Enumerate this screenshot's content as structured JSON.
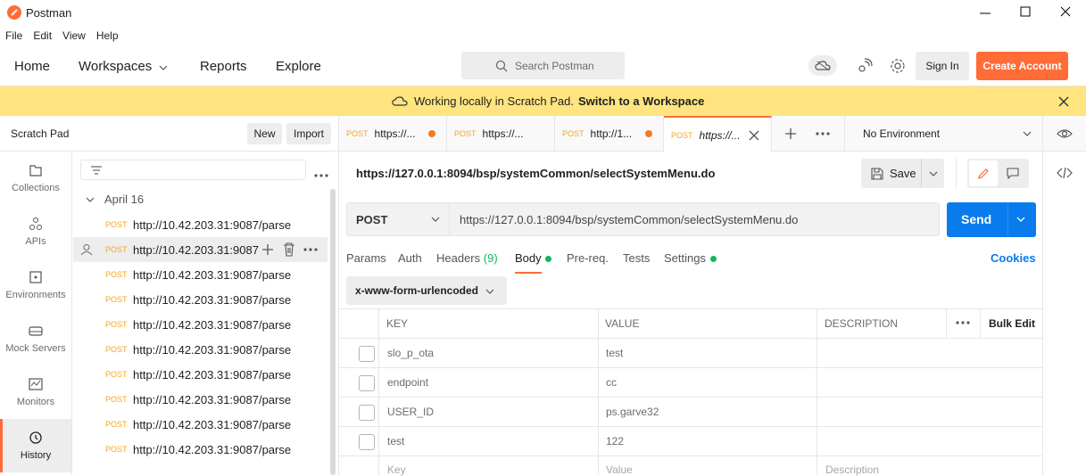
{
  "app": {
    "title": "Postman"
  },
  "menu": [
    "File",
    "Edit",
    "View",
    "Help"
  ],
  "nav": {
    "home": "Home",
    "workspaces": "Workspaces",
    "reports": "Reports",
    "explore": "Explore",
    "search_placeholder": "Search Postman",
    "sign_in": "Sign In",
    "create_account": "Create Account"
  },
  "banner": {
    "text": "Working locally in Scratch Pad.",
    "link": "Switch to a Workspace"
  },
  "scratch": {
    "title": "Scratch Pad",
    "new": "New",
    "import": "Import"
  },
  "sidebar": [
    {
      "label": "Collections",
      "icon": "collections-icon"
    },
    {
      "label": "APIs",
      "icon": "apis-icon"
    },
    {
      "label": "Environments",
      "icon": "environments-icon"
    },
    {
      "label": "Mock Servers",
      "icon": "mock-servers-icon"
    },
    {
      "label": "Monitors",
      "icon": "monitors-icon"
    },
    {
      "label": "History",
      "icon": "history-icon",
      "active": true
    }
  ],
  "history": {
    "group": "April 16",
    "items": [
      {
        "method": "POST",
        "url": "http://10.42.203.31:9087/parse"
      },
      {
        "method": "POST",
        "url": "http://10.42.203.31:9087"
      },
      {
        "method": "POST",
        "url": "http://10.42.203.31:9087/parse"
      },
      {
        "method": "POST",
        "url": "http://10.42.203.31:9087/parse"
      },
      {
        "method": "POST",
        "url": "http://10.42.203.31:9087/parse"
      },
      {
        "method": "POST",
        "url": "http://10.42.203.31:9087/parse"
      },
      {
        "method": "POST",
        "url": "http://10.42.203.31:9087/parse"
      },
      {
        "method": "POST",
        "url": "http://10.42.203.31:9087/parse"
      },
      {
        "method": "POST",
        "url": "http://10.42.203.31:9087/parse"
      },
      {
        "method": "POST",
        "url": "http://10.42.203.31:9087/parse"
      }
    ]
  },
  "tabs": [
    {
      "method": "POST",
      "title": "https://...",
      "dirty": true
    },
    {
      "method": "POST",
      "title": "https://...",
      "dirty": false
    },
    {
      "method": "POST",
      "title": "http://1...",
      "dirty": true
    },
    {
      "method": "POST",
      "title": "https://...",
      "active": true
    }
  ],
  "environment": "No Environment",
  "request": {
    "title": "https://127.0.0.1:8094/bsp/systemCommon/selectSystemMenu.do",
    "method": "POST",
    "url": "https://127.0.0.1:8094/bsp/systemCommon/selectSystemMenu.do",
    "save": "Save",
    "send": "Send"
  },
  "subtabs": {
    "params": "Params",
    "auth": "Auth",
    "headers": "Headers",
    "headers_count": "(9)",
    "body": "Body",
    "prereq": "Pre-req.",
    "tests": "Tests",
    "settings": "Settings",
    "cookies": "Cookies"
  },
  "body_type": "x-www-form-urlencoded",
  "table": {
    "headers": {
      "key": "KEY",
      "value": "VALUE",
      "description": "DESCRIPTION",
      "bulk": "Bulk Edit"
    },
    "rows": [
      {
        "key": "slo_p_ota",
        "value": "test"
      },
      {
        "key": "endpoint",
        "value": "cc"
      },
      {
        "key": "USER_ID",
        "value": "ps.garve32"
      },
      {
        "key": "test",
        "value": "122"
      }
    ],
    "placeholder": {
      "key": "Key",
      "value": "Value",
      "description": "Description"
    }
  },
  "colors": {
    "accent": "#ff6c37",
    "send": "#097bed",
    "banner": "#ffe47f",
    "method": "#f6a623",
    "dot": "#f47c1f",
    "green": "#0cbb52"
  }
}
